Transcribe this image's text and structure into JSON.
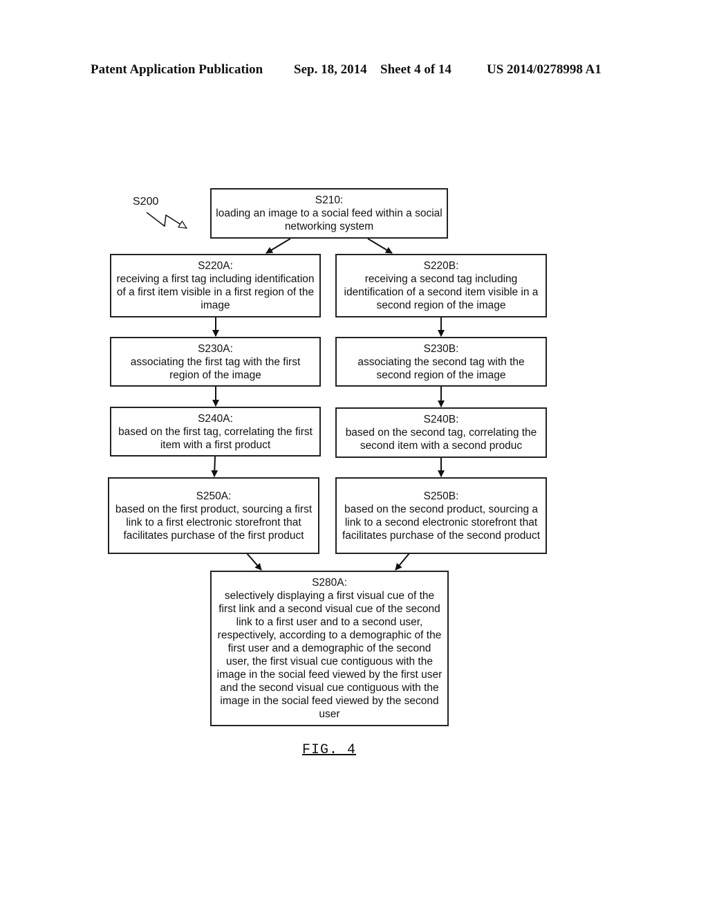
{
  "header": {
    "publication": "Patent Application Publication",
    "date": "Sep. 18, 2014",
    "sheet": "Sheet 4 of 14",
    "number": "US 2014/0278998 A1"
  },
  "diagram": {
    "method_label": "S200",
    "figure_label": "FIG. 4",
    "steps": {
      "s210": {
        "label": "S210:",
        "text": "loading an image to a social feed within a social networking system"
      },
      "s220a": {
        "label": "S220A:",
        "text": "receiving a first tag including identification of a first item visible in a first region of the image"
      },
      "s220b": {
        "label": "S220B:",
        "text": "receiving a second tag including identification of a second item visible in a second region of the image"
      },
      "s230a": {
        "label": "S230A:",
        "text": "associating the first tag with the first region of the image"
      },
      "s230b": {
        "label": "S230B:",
        "text": "associating the second tag with the second region of the image"
      },
      "s240a": {
        "label": "S240A:",
        "text": "based on the first tag, correlating the first item with a first product"
      },
      "s240b": {
        "label": "S240B:",
        "text": "based on the second tag, correlating the second item with a second produc"
      },
      "s250a": {
        "label": "S250A:",
        "text": "based on the first product, sourcing a first link to a first electronic storefront that facilitates purchase of the first product"
      },
      "s250b": {
        "label": "S250B:",
        "text": "based on the second product, sourcing a link to a second electronic storefront that facilitates purchase of the second product"
      },
      "s280a": {
        "label": "S280A:",
        "text": "selectively displaying a first visual cue of the first link and a second visual cue of the second link to a first user and to a second user, respectively, according to a demographic of the first user and a demographic of the second user, the first visual cue contiguous with the image in the social feed viewed by the first user and the second visual cue contiguous with the image in the social feed viewed by the second user"
      }
    }
  }
}
